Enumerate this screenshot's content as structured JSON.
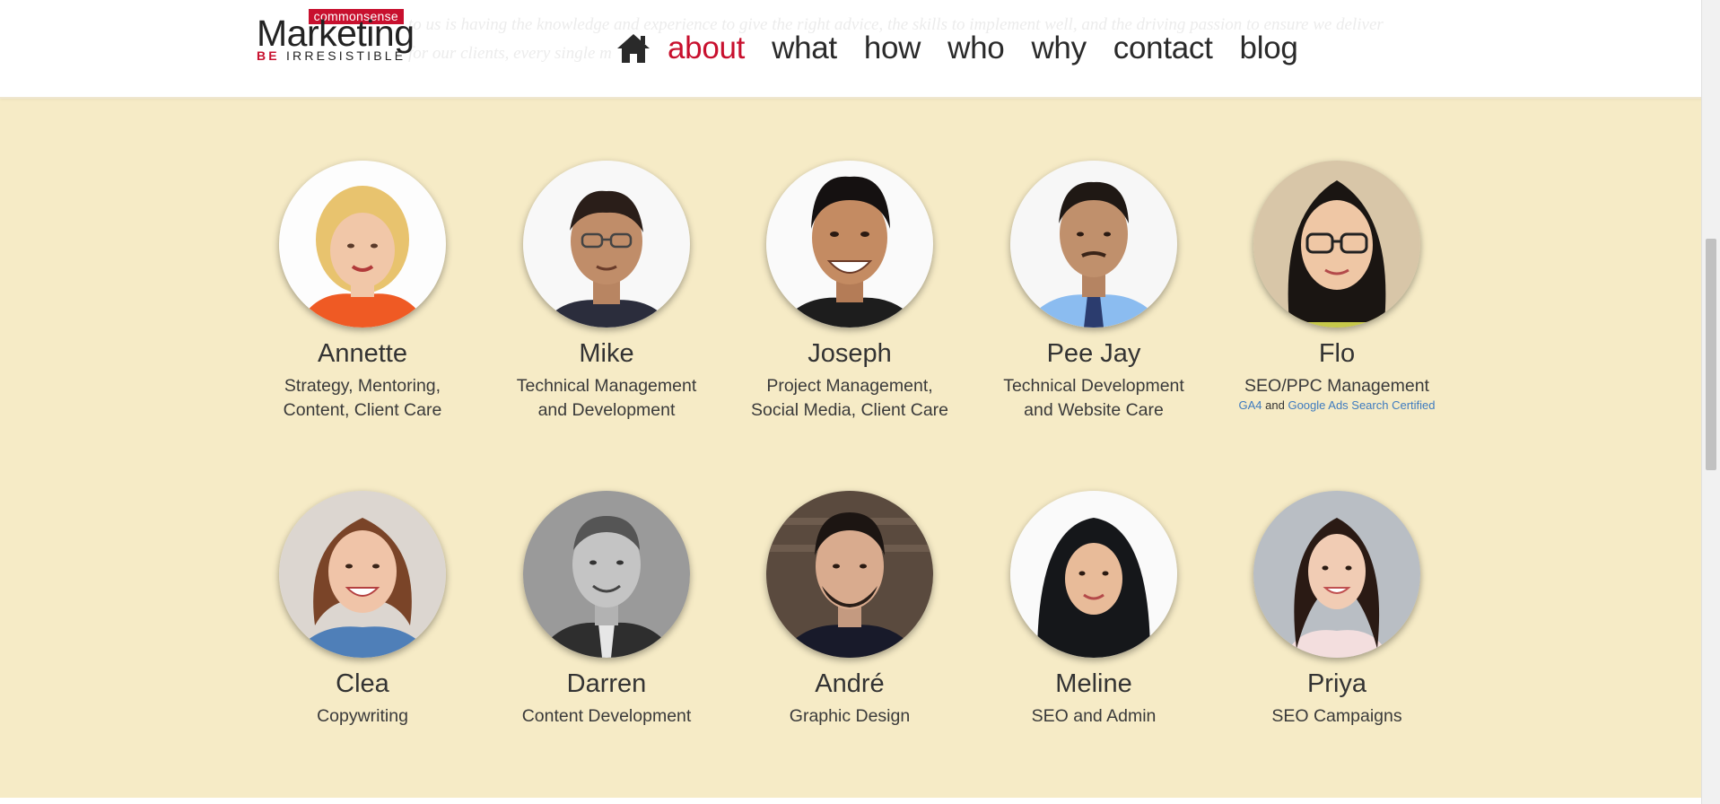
{
  "header": {
    "ghost_line1": "to us is having the knowledge and experience to give the right advice, the skills to implement well, and the driving passion to ensure we deliver",
    "ghost_line2": "for our clients, every single m",
    "logo": {
      "tag": "commonsense",
      "main": "Marketing",
      "be": "BE",
      "sub": "IRRESISTIBLE"
    },
    "nav": {
      "home_icon": "home-icon",
      "items": [
        "about",
        "what",
        "how",
        "who",
        "why",
        "contact",
        "blog"
      ],
      "active": "about"
    }
  },
  "team": [
    {
      "name": "Annette",
      "role_line1": "Strategy, Mentoring,",
      "role_line2": "Content, Client Care"
    },
    {
      "name": "Mike",
      "role_line1": "Technical Management",
      "role_line2": "and Development"
    },
    {
      "name": "Joseph",
      "role_line1": "Project Management,",
      "role_line2": "Social Media, Client Care"
    },
    {
      "name": "Pee Jay",
      "role_line1": "Technical Development",
      "role_line2": "and Website Care"
    },
    {
      "name": "Flo",
      "role_line1": "SEO/PPC Management",
      "cert_a": "GA4",
      "cert_and": "and",
      "cert_b": "Google Ads Search Certified"
    },
    {
      "name": "Clea",
      "role_line1": "Copywriting"
    },
    {
      "name": "Darren",
      "role_line1": "Content Development"
    },
    {
      "name": "André",
      "role_line1": "Graphic Design"
    },
    {
      "name": "Meline",
      "role_line1": "SEO and Admin"
    },
    {
      "name": "Priya",
      "role_line1": "SEO Campaigns"
    }
  ],
  "colors": {
    "accent": "#c8102e",
    "background": "#f6ebc6",
    "link": "#3e7bbf"
  }
}
